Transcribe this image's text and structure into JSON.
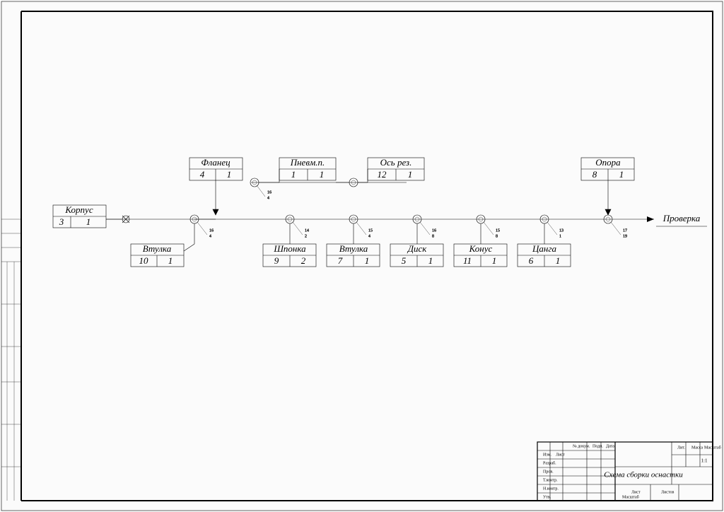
{
  "drawing_title": "Схема сборки оснастки",
  "scale": "1:1",
  "check_label": "Проверка",
  "footer_note": "Масштаб",
  "parts": {
    "korpus": {
      "name": "Корпус",
      "pos": "3",
      "qty": "1"
    },
    "vtulka10": {
      "name": "Втулка",
      "pos": "10",
      "qty": "1"
    },
    "flanets": {
      "name": "Фланец",
      "pos": "4",
      "qty": "1"
    },
    "pnevm": {
      "name": "Пневм.п.",
      "pos": "1",
      "qty": "1"
    },
    "osrez": {
      "name": "Ось рез.",
      "pos": "12",
      "qty": "1"
    },
    "shponka": {
      "name": "Шпонка",
      "pos": "9",
      "qty": "2"
    },
    "vtulka7": {
      "name": "Втулка",
      "pos": "7",
      "qty": "1"
    },
    "disk": {
      "name": "Диск",
      "pos": "5",
      "qty": "1"
    },
    "konus": {
      "name": "Конус",
      "pos": "11",
      "qty": "1"
    },
    "tsanga": {
      "name": "Цанга",
      "pos": "6",
      "qty": "1"
    },
    "opora": {
      "name": "Опора",
      "pos": "8",
      "qty": "1"
    }
  },
  "annotations": {
    "a1": {
      "top": "16",
      "bot": "4"
    },
    "a2": {
      "top": "16",
      "bot": "4"
    },
    "a3": {
      "top": "14",
      "bot": "2"
    },
    "a4": {
      "top": "15",
      "bot": "4"
    },
    "a5": {
      "top": "16",
      "bot": "8"
    },
    "a6": {
      "top": "15",
      "bot": "8"
    },
    "a7": {
      "top": "13",
      "bot": "1"
    },
    "a8": {
      "top": "17",
      "bot": "19"
    }
  },
  "titleblock": {
    "rows": [
      "Изм.",
      "Лист",
      "Разраб.",
      "Пров.",
      "Т.контр.",
      "Н.контр.",
      "Утв."
    ],
    "cols": [
      "№ докум.",
      "Подп.",
      "Дата"
    ],
    "stamp": [
      "Лит.",
      "Масса",
      "Масштаб"
    ],
    "sheet": [
      "Лист",
      "Листов"
    ]
  }
}
